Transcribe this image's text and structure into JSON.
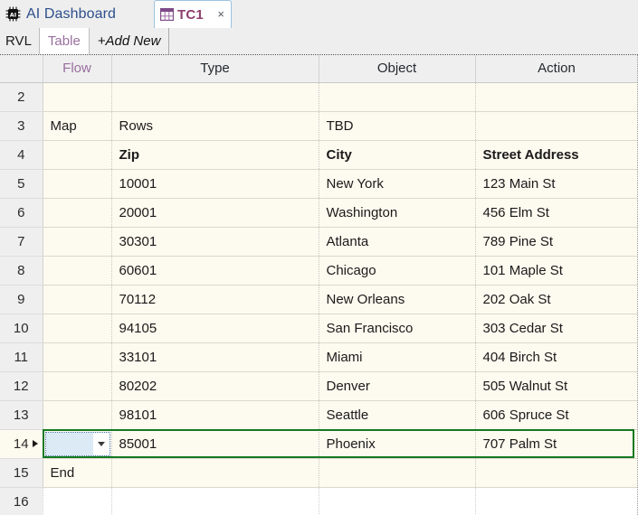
{
  "window": {
    "app_title": "AI Dashboard",
    "app_icon": "ai-chip-icon"
  },
  "tabs": [
    {
      "label": "TC1",
      "icon": "table-grid-icon",
      "close_label": "×",
      "active": true
    }
  ],
  "subtabs": {
    "items": [
      {
        "label": "RVL",
        "active": false
      },
      {
        "label": "Table",
        "active": true
      },
      {
        "label": "+Add New",
        "active": false
      }
    ]
  },
  "grid": {
    "columns": [
      {
        "key": "rowhdr",
        "label": ""
      },
      {
        "key": "flow",
        "label": "Flow"
      },
      {
        "key": "type",
        "label": "Type"
      },
      {
        "key": "object",
        "label": "Object"
      },
      {
        "key": "action",
        "label": "Action"
      }
    ],
    "rows": [
      {
        "num": "2",
        "flow": "",
        "type": "",
        "object": "",
        "action": "",
        "bold": false,
        "blank": false,
        "selected": false,
        "editor": false
      },
      {
        "num": "3",
        "flow": "Map",
        "type": "Rows",
        "object": "TBD",
        "action": "",
        "bold": false,
        "blank": false,
        "selected": false,
        "editor": false
      },
      {
        "num": "4",
        "flow": "",
        "type": "Zip",
        "object": "City",
        "action": "Street Address",
        "bold": true,
        "blank": false,
        "selected": false,
        "editor": false
      },
      {
        "num": "5",
        "flow": "",
        "type": "10001",
        "object": "New York",
        "action": "123 Main St",
        "bold": false,
        "blank": false,
        "selected": false,
        "editor": false
      },
      {
        "num": "6",
        "flow": "",
        "type": "20001",
        "object": "Washington",
        "action": "456 Elm St",
        "bold": false,
        "blank": false,
        "selected": false,
        "editor": false
      },
      {
        "num": "7",
        "flow": "",
        "type": "30301",
        "object": "Atlanta",
        "action": "789 Pine St",
        "bold": false,
        "blank": false,
        "selected": false,
        "editor": false
      },
      {
        "num": "8",
        "flow": "",
        "type": "60601",
        "object": "Chicago",
        "action": "101 Maple St",
        "bold": false,
        "blank": false,
        "selected": false,
        "editor": false
      },
      {
        "num": "9",
        "flow": "",
        "type": "70112",
        "object": "New Orleans",
        "action": "202 Oak St",
        "bold": false,
        "blank": false,
        "selected": false,
        "editor": false
      },
      {
        "num": "10",
        "flow": "",
        "type": "94105",
        "object": "San Francisco",
        "action": "303 Cedar St",
        "bold": false,
        "blank": false,
        "selected": false,
        "editor": false
      },
      {
        "num": "11",
        "flow": "",
        "type": "33101",
        "object": "Miami",
        "action": "404 Birch St",
        "bold": false,
        "blank": false,
        "selected": false,
        "editor": false
      },
      {
        "num": "12",
        "flow": "",
        "type": "80202",
        "object": "Denver",
        "action": "505 Walnut St",
        "bold": false,
        "blank": false,
        "selected": false,
        "editor": false
      },
      {
        "num": "13",
        "flow": "",
        "type": "98101",
        "object": "Seattle",
        "action": "606 Spruce St",
        "bold": false,
        "blank": false,
        "selected": false,
        "editor": false
      },
      {
        "num": "14",
        "flow": "",
        "type": "85001",
        "object": "Phoenix",
        "action": "707 Palm St",
        "bold": false,
        "blank": false,
        "selected": true,
        "editor": true
      },
      {
        "num": "15",
        "flow": "End",
        "type": "",
        "object": "",
        "action": "",
        "bold": false,
        "blank": false,
        "selected": false,
        "editor": false
      },
      {
        "num": "16",
        "flow": "",
        "type": "",
        "object": "",
        "action": "",
        "bold": false,
        "blank": true,
        "selected": false,
        "editor": false
      }
    ],
    "editor": {
      "value": "",
      "placeholder": "",
      "dropdown_icon": "chevron-down-icon"
    },
    "current_row_marker": "▶"
  },
  "colors": {
    "accent_purple": "#9a6fa0",
    "tab_label": "#8e3f6e",
    "app_title": "#2c4f8c",
    "selection_green": "#157a22",
    "cell_bg": "#fdfaef",
    "editor_bg": "#dceaf5",
    "header_bg": "#efefef"
  }
}
